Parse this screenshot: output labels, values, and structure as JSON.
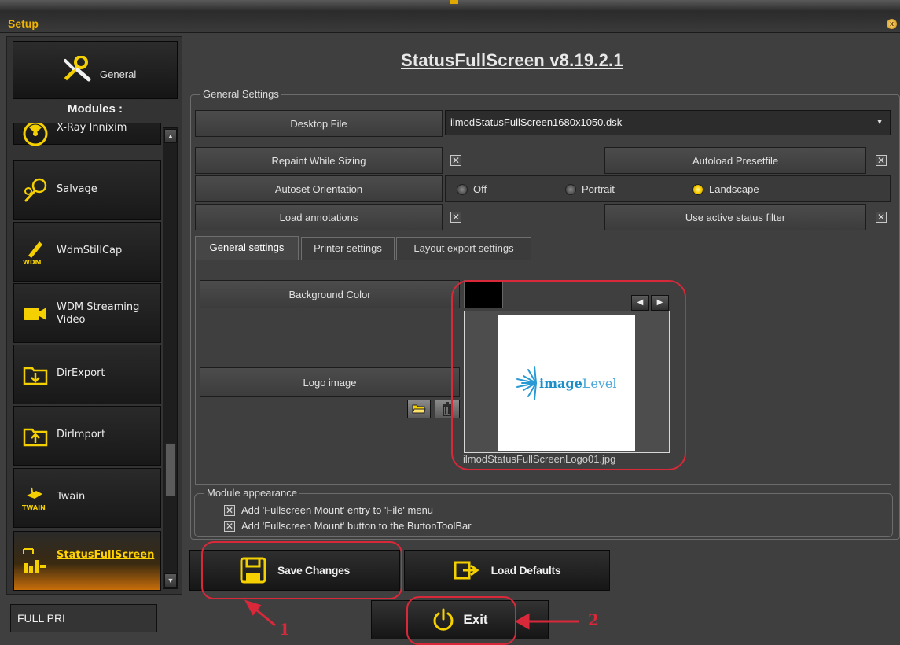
{
  "window": {
    "title": "Setup",
    "close_label": "x"
  },
  "app_title": "StatusFullScreen v8.19.2.1",
  "sidebar": {
    "general_label": "General",
    "modules_header": "Modules :",
    "items": [
      {
        "label": "X-Ray Innixim",
        "icon": "radiation-icon"
      },
      {
        "label": "Salvage",
        "icon": "salvage-icon"
      },
      {
        "label": "WdmStillCap",
        "icon": "wdm-pen-icon"
      },
      {
        "label": "WDM Streaming Video",
        "icon": "video-camera-icon"
      },
      {
        "label": "DirExport",
        "icon": "folder-export-icon"
      },
      {
        "label": "DirImport",
        "icon": "folder-import-icon"
      },
      {
        "label": "Twain",
        "icon": "twain-icon"
      },
      {
        "label": "StatusFullScreen",
        "icon": "statusfullscreen-icon",
        "active": true
      }
    ]
  },
  "general_settings": {
    "group_label": "General Settings",
    "desktop_file_label": "Desktop File",
    "desktop_file_value": "ilmodStatusFullScreen1680x1050.dsk",
    "repaint_label": "Repaint While Sizing",
    "repaint_checked": true,
    "autoload_label": "Autoload Presetfile",
    "autoload_checked": true,
    "orientation_label": "Autoset Orientation",
    "orientation_options": [
      "Off",
      "Portrait",
      "Landscape"
    ],
    "orientation_selected": "Landscape",
    "annotations_label": "Load annotations",
    "annotations_checked": true,
    "status_filter_label": "Use active status filter",
    "status_filter_checked": true
  },
  "tabs": [
    "General settings",
    "Printer settings",
    "Layout export settings"
  ],
  "active_tab": "General settings",
  "tab_general": {
    "background_color_label": "Background Color",
    "background_color": "#000000",
    "logo_image_label": "Logo image",
    "logo_brand": "imageLevel",
    "logo_brand_bold": "image",
    "logo_brand_light": "Level",
    "logo_filename": "ilmodStatusFullScreenLogo01.jpg"
  },
  "module_appearance": {
    "group_label": "Module appearance",
    "options": [
      {
        "label": "Add 'Fullscreen Mount' entry to 'File' menu",
        "checked": true
      },
      {
        "label": "Add 'Fullscreen Mount' button to the ButtonToolBar",
        "checked": true
      }
    ]
  },
  "buttons": {
    "save": "Save Changes",
    "load_defaults": "Load Defaults",
    "exit": "Exit"
  },
  "status_field": "FULL PRI",
  "annotations": {
    "one": "1",
    "two": "2",
    "color": "#d8283a"
  },
  "colors": {
    "accent": "#f0b400",
    "active_orange": "#c86e0a",
    "radio_on": "#ffd200"
  }
}
